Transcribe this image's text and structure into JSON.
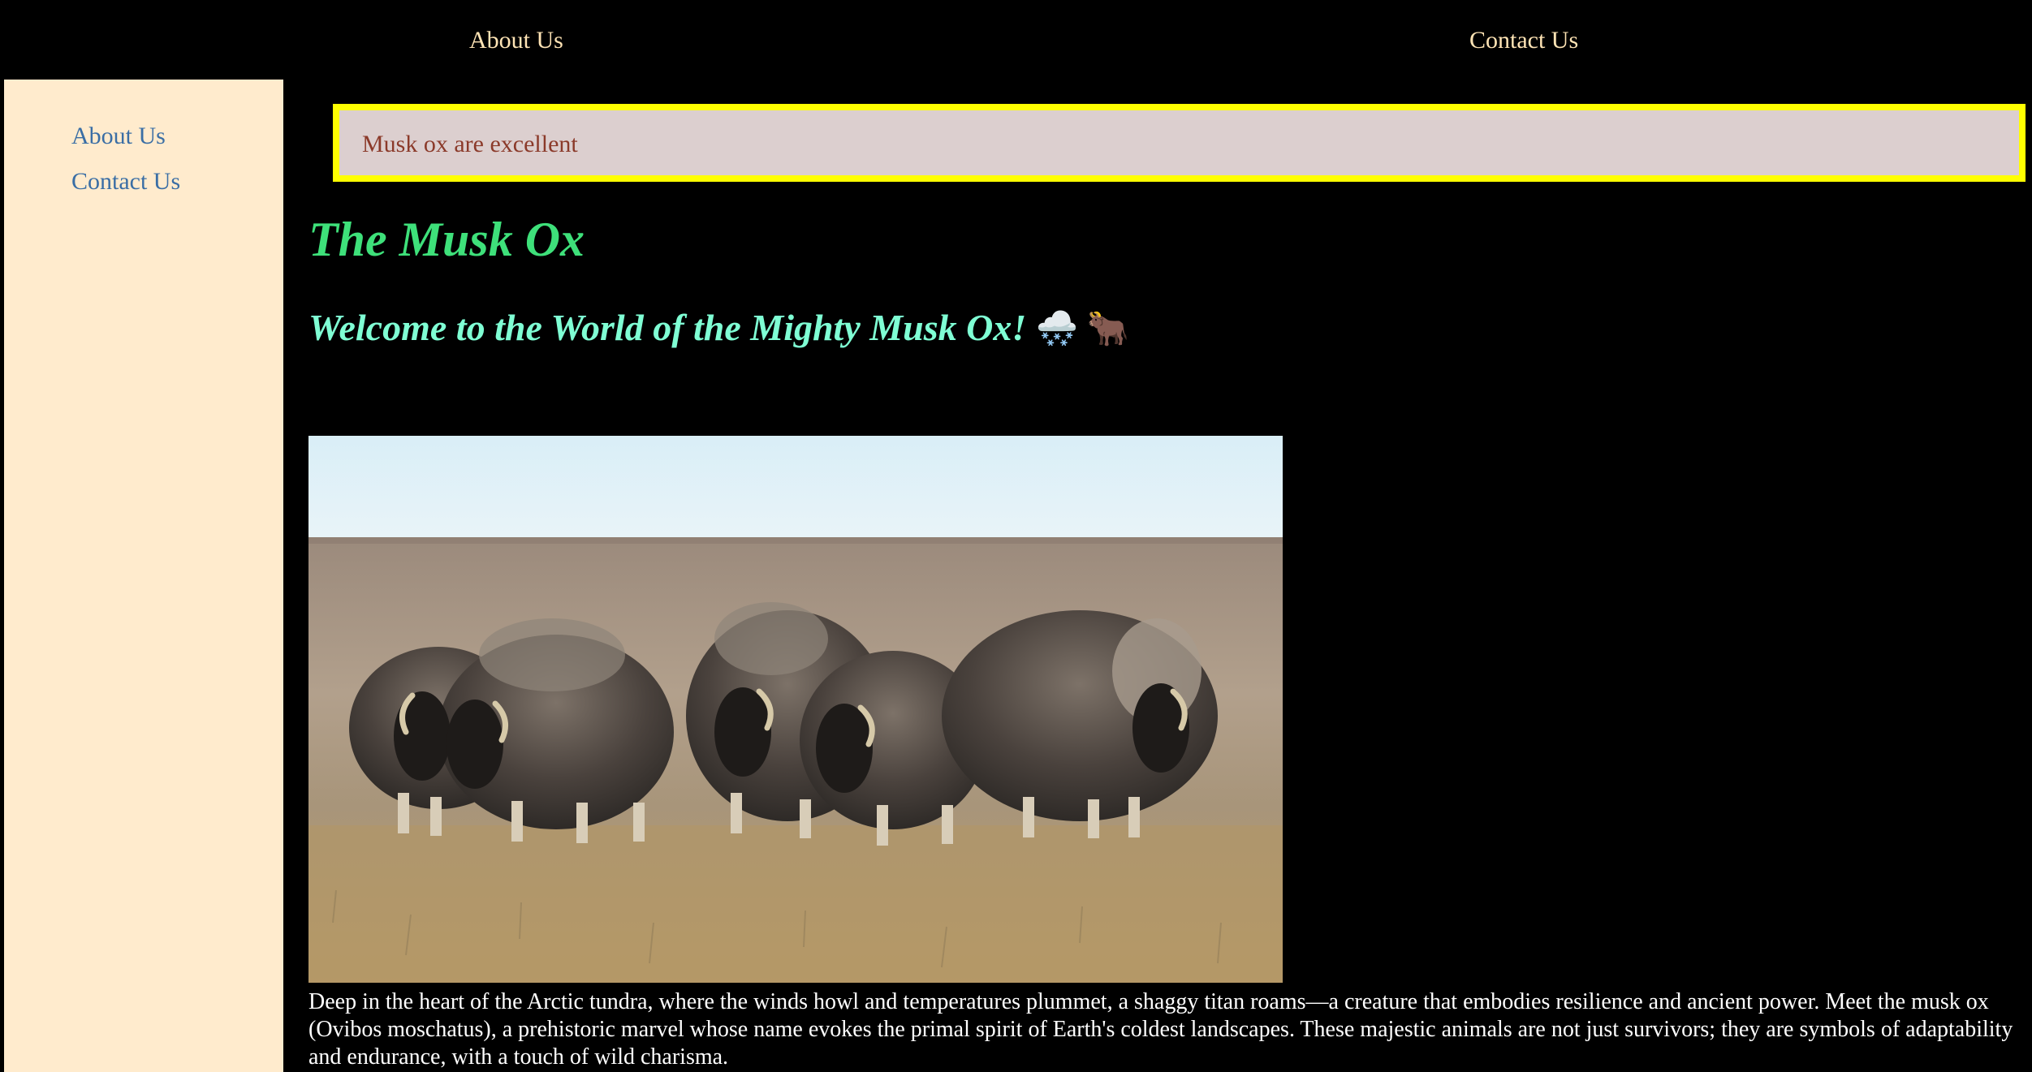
{
  "topnav": {
    "about_label": "About Us",
    "contact_label": "Contact Us"
  },
  "sidebar": {
    "items": [
      {
        "label": "About Us"
      },
      {
        "label": "Contact Us"
      }
    ]
  },
  "banner": {
    "text": "Musk ox are excellent"
  },
  "page": {
    "title": "The Musk Ox",
    "subtitle": "Welcome to the World of the Mighty Musk Ox!",
    "subtitle_emoji": "🌨️ 🐂",
    "intro": "Deep in the heart of the Arctic tundra, where the winds howl and temperatures plummet, a shaggy titan roams—a creature that embodies resilience and ancient power. Meet the musk ox (Ovibos moschatus), a prehistoric marvel whose name evokes the primal spirit of Earth's coldest landscapes. These majestic animals are not just survivors; they are symbols of adaptability and endurance, with a touch of wild charisma."
  },
  "colors": {
    "background": "#000000",
    "topnav_link": "#ffe4b5",
    "sidebar_bg": "#ffebcd",
    "sidebar_link": "#3a6ea5",
    "banner_bg": "#dccfcf",
    "banner_border": "#ffff00",
    "banner_text": "#8b3a2a",
    "title": "#3ee07a",
    "subtitle": "#7fffd4",
    "body_text": "#ffffff"
  },
  "image": {
    "subject": "herd of musk oxen on arctic tundra"
  }
}
